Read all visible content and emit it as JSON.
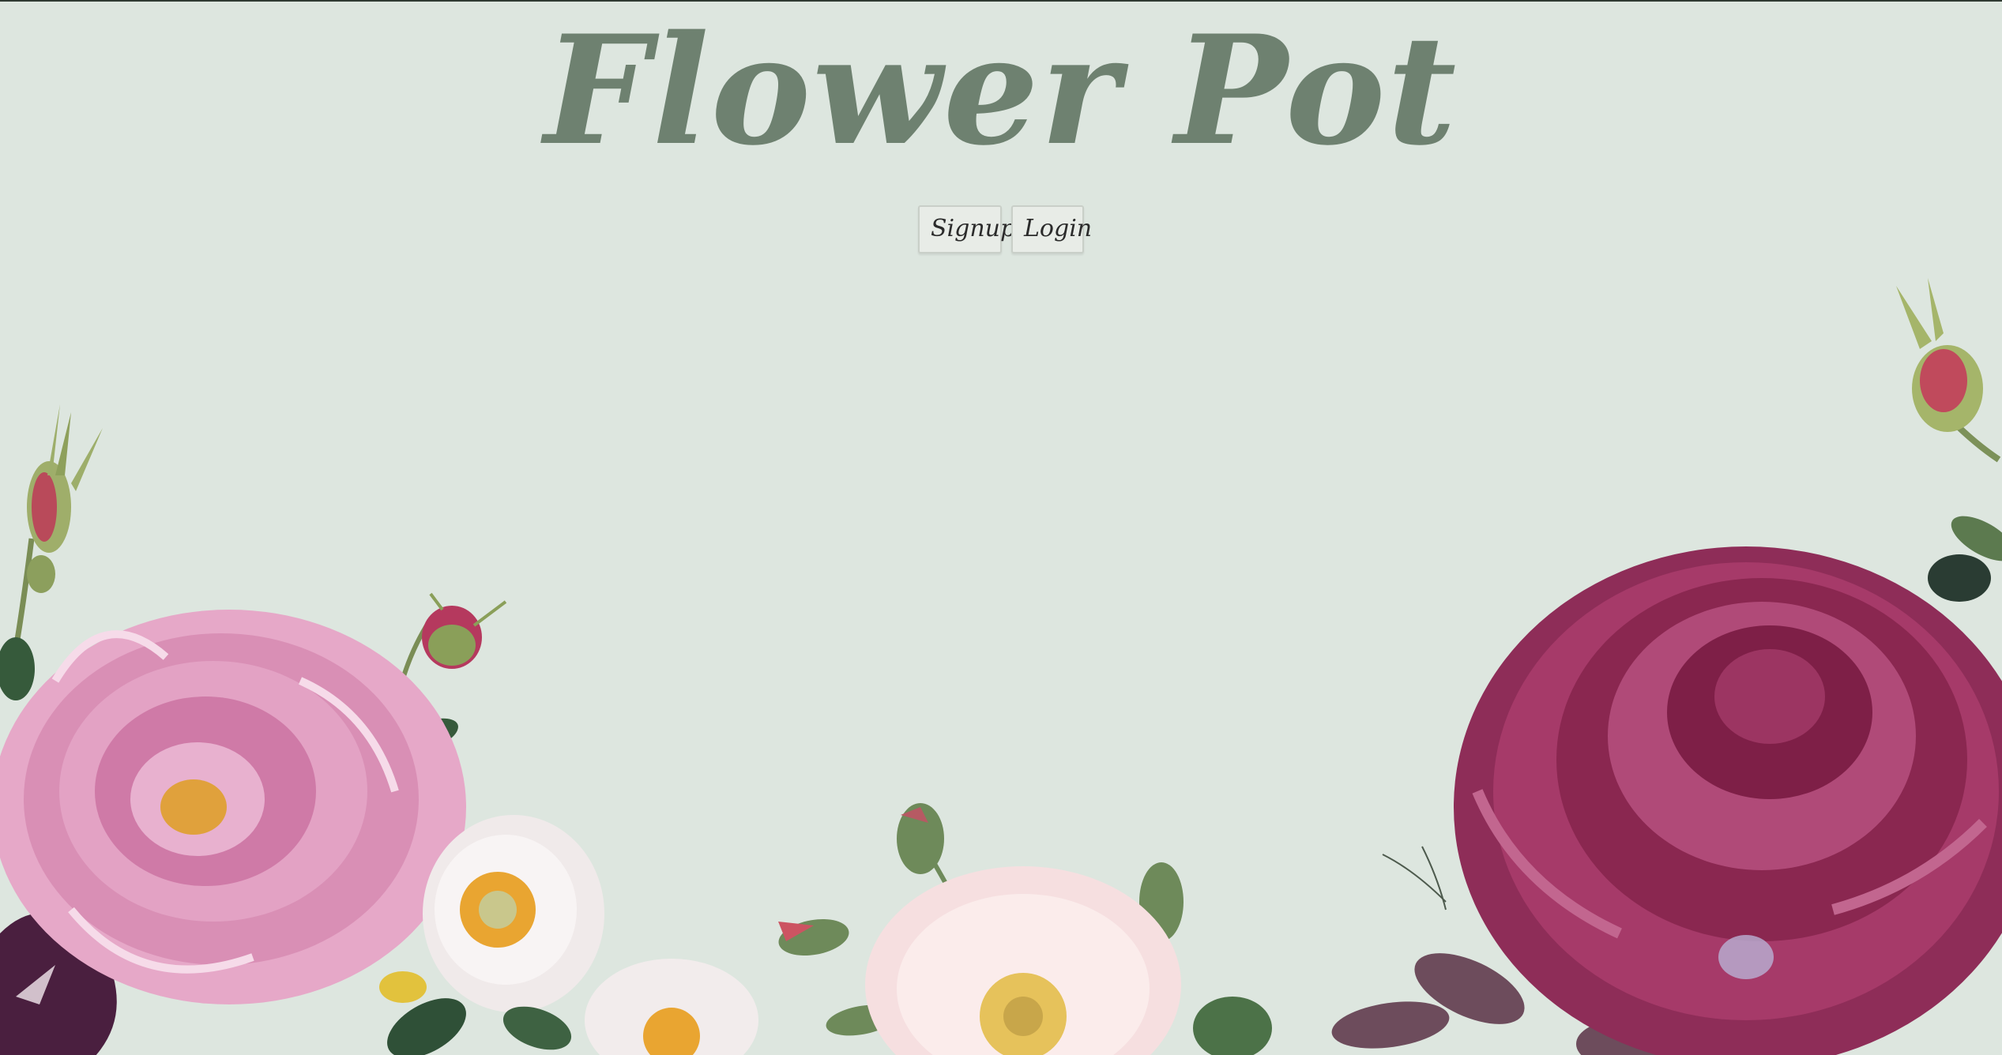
{
  "header": {
    "title": "Flower Pot"
  },
  "auth": {
    "signup_label": "Signup",
    "login_label": "Login"
  },
  "colors": {
    "background": "#dde6df",
    "title": "#6e8170",
    "pink_peony": "#d98fb5",
    "magenta_rose": "#9b2e5c",
    "white_bloom": "#f4eeee",
    "leaf_green": "#4f6e4a"
  }
}
